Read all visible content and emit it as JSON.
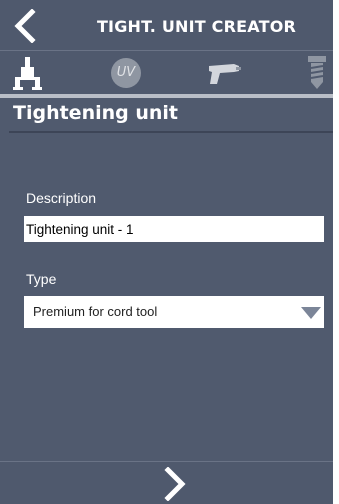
{
  "header": {
    "title": "TIGHT. UNIT CREATOR",
    "back_icon": "chevron-left-icon"
  },
  "toolbar": {
    "items": [
      {
        "icon": "clamp-fixture-icon"
      },
      {
        "icon": "uv-icon",
        "text": "UV"
      },
      {
        "icon": "screwdriver-gun-icon"
      },
      {
        "icon": "screw-icon"
      }
    ]
  },
  "page": {
    "title": "Tightening unit"
  },
  "form": {
    "description_label": "Description",
    "description_value": "Tightening unit - 1",
    "type_label": "Type",
    "type_value": "Premium for cord tool"
  },
  "footer": {
    "next_icon": "chevron-right-icon"
  },
  "colors": {
    "background": "#505a6e",
    "bars": "#4f596d",
    "icon_white": "#ffffff",
    "icon_gray": "#8f96a2",
    "select_arrow": "#7b8598"
  }
}
